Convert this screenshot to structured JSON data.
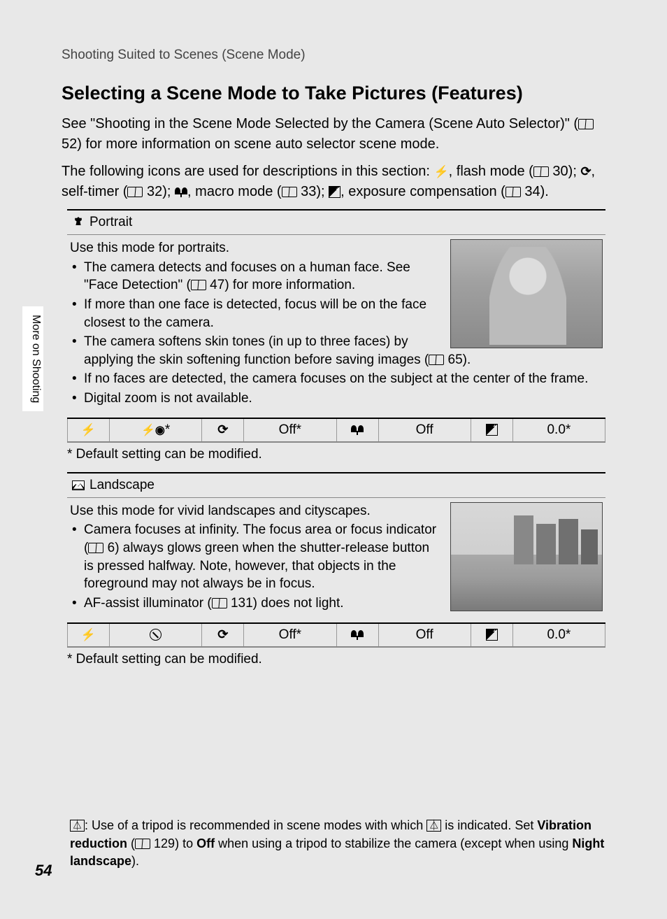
{
  "breadcrumb": "Shooting Suited to Scenes (Scene Mode)",
  "side_tab": "More on Shooting",
  "page_number": "54",
  "title": "Selecting a Scene Mode to Take Pictures (Features)",
  "intro1_a": "See \"Shooting in the Scene Mode Selected by the Camera (Scene Auto Selector)\" (",
  "intro1_ref": "52",
  "intro1_b": ") for more information on scene auto selector scene mode.",
  "intro2_a": "The following icons are used for descriptions in this section: ",
  "intro2_flash": ", flash mode (",
  "intro2_ref30": "30",
  "intro2_b": "); ",
  "intro2_timer": ", self-timer (",
  "intro2_ref32": "32",
  "intro2_c": "); ",
  "intro2_macro": ", macro mode (",
  "intro2_ref33": "33",
  "intro2_d": "); ",
  "intro2_exp": ", exposure compensation (",
  "intro2_ref34": "34",
  "intro2_e": ").",
  "portrait": {
    "heading": "Portrait",
    "lead": "Use this mode for portraits.",
    "b1a": "The camera detects and focuses on a human face. See \"Face Detection\" (",
    "b1ref": "47",
    "b1b": ") for more information.",
    "b2": "If more than one face is detected, focus will be on the face closest to the camera.",
    "b3a": "The camera softens skin tones (in up to three faces) by applying the skin softening function before saving images (",
    "b3ref": "65",
    "b3b": ").",
    "b4": "If no faces are detected, the camera focuses on the subject at the center of the frame.",
    "b5": "Digital zoom is not available.",
    "settings": {
      "flash_value": "⚡◉*",
      "timer_value": "Off*",
      "macro_value": "Off",
      "exp_value": "0.0*"
    },
    "footnote": "*   Default setting can be modified."
  },
  "landscape": {
    "heading": "Landscape",
    "lead": "Use this mode for vivid landscapes and cityscapes.",
    "b1a": "Camera focuses at infinity. The focus area or focus indicator (",
    "b1ref": "6",
    "b1b": ") always glows green when the shutter-release button is pressed halfway. Note, however, that objects in the foreground may not always be in focus.",
    "b2a": "AF-assist illuminator (",
    "b2ref": "131",
    "b2b": ") does not light.",
    "settings": {
      "flash_value": "⊘",
      "timer_value": "Off*",
      "macro_value": "Off",
      "exp_value": "0.0*"
    },
    "footnote": "*   Default setting can be modified."
  },
  "tripod_note": {
    "a": ": Use of a tripod is recommended in scene modes with which ",
    "b": " is indicated. Set ",
    "bold1": "Vibration reduction",
    "c": " (",
    "ref": "129",
    "d": ") to ",
    "bold2": "Off",
    "e": " when using a tripod to stabilize the camera (except when using ",
    "bold3": "Night landscape",
    "f": ")."
  },
  "icons": {
    "tripod_glyph": "⚱"
  }
}
